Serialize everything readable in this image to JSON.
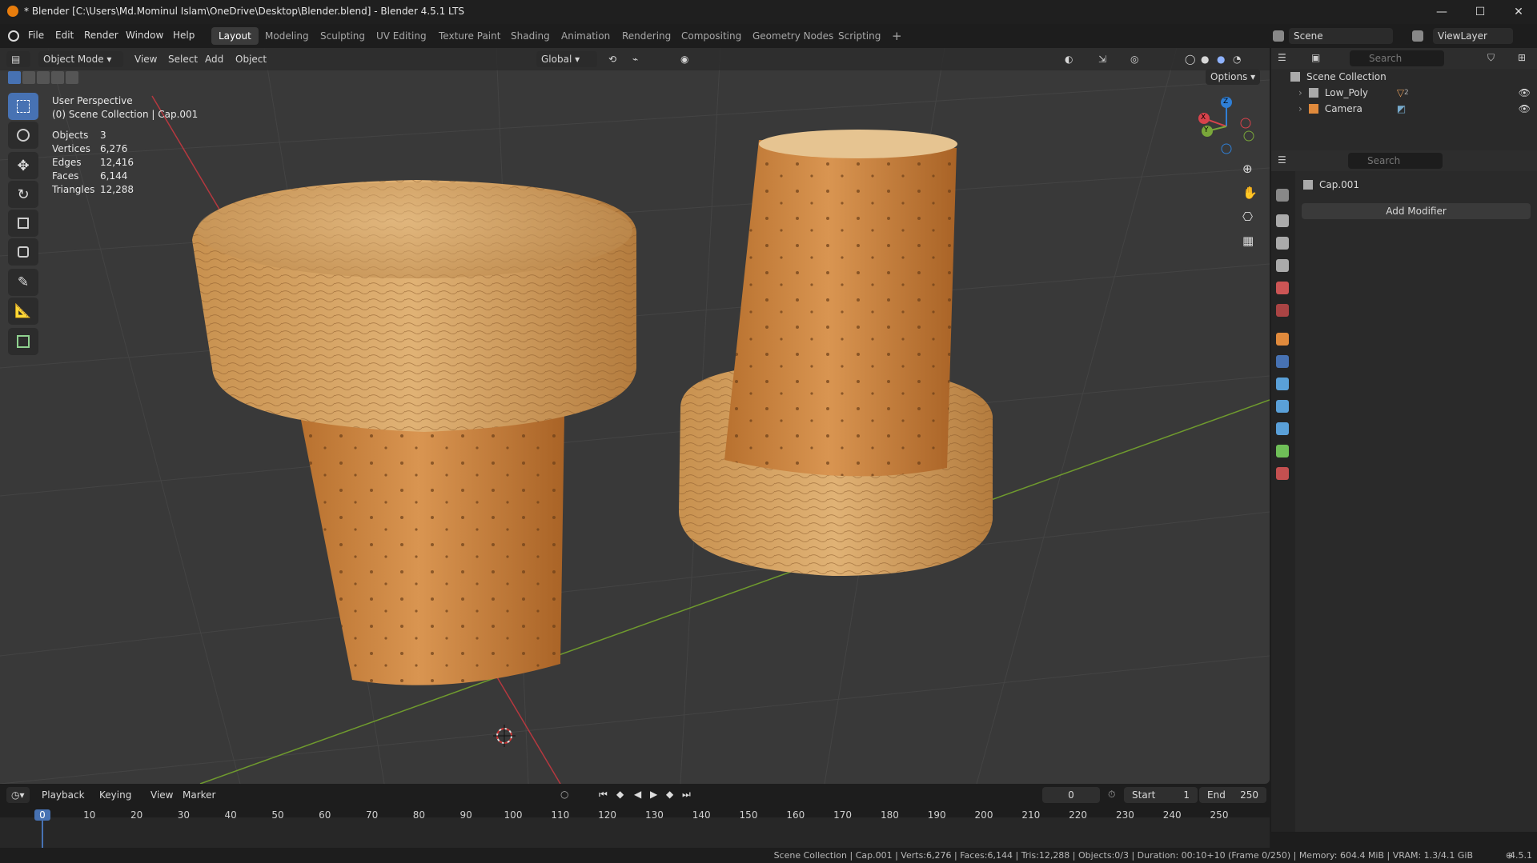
{
  "window": {
    "title": "* Blender [C:\\Users\\Md.Mominul Islam\\OneDrive\\Desktop\\Blender.blend] - Blender 4.5.1 LTS",
    "minimize": "—",
    "maximize": "☐",
    "close": "✕"
  },
  "menu": {
    "items": [
      "File",
      "Edit",
      "Render",
      "Window",
      "Help"
    ]
  },
  "workspaces": {
    "tabs": [
      "Layout",
      "Modeling",
      "Sculpting",
      "UV Editing",
      "Texture Paint",
      "Shading",
      "Animation",
      "Rendering",
      "Compositing",
      "Geometry Nodes",
      "Scripting"
    ],
    "active": "Layout",
    "add": "+"
  },
  "scene": {
    "label": "Scene",
    "viewlayer": "ViewLayer"
  },
  "viewport_header": {
    "mode": "Object Mode",
    "menus": [
      "View",
      "Select",
      "Add",
      "Object"
    ],
    "orientation": "Global",
    "options": "Options"
  },
  "overlay_info": {
    "perspective": "User Perspective",
    "collection": "(0) Scene Collection | Cap.001",
    "stats": [
      {
        "label": "Objects",
        "value": "3"
      },
      {
        "label": "Vertices",
        "value": "6,276"
      },
      {
        "label": "Edges",
        "value": "12,416"
      },
      {
        "label": "Faces",
        "value": "6,144"
      },
      {
        "label": "Triangles",
        "value": "12,288"
      }
    ]
  },
  "gizmo": {
    "x": "X",
    "y": "Y",
    "z": "Z"
  },
  "outliner": {
    "search_placeholder": "Search",
    "root": "Scene Collection",
    "items": [
      {
        "name": "Low_Poly",
        "badge": "2"
      },
      {
        "name": "Camera"
      }
    ]
  },
  "properties": {
    "search_placeholder": "Search",
    "object_name": "Cap.001",
    "add_modifier": "Add Modifier"
  },
  "timeline": {
    "menus": [
      "Playback",
      "Keying",
      "View",
      "Marker"
    ],
    "current_frame": "0",
    "start_label": "Start",
    "start_value": "1",
    "end_label": "End",
    "end_value": "250",
    "ticks": [
      "0",
      "10",
      "20",
      "30",
      "40",
      "50",
      "60",
      "70",
      "80",
      "90",
      "100",
      "110",
      "120",
      "130",
      "140",
      "150",
      "160",
      "170",
      "180",
      "190",
      "200",
      "210",
      "220",
      "230",
      "240",
      "250"
    ]
  },
  "statusbar": {
    "text": "Scene Collection | Cap.001 | Verts:6,276 | Faces:6,144 | Tris:12,288 | Objects:0/3 | Duration: 00:10+10 (Frame 0/250) | Memory: 604.4 MiB | VRAM: 1.3/4.1 GiB",
    "version": "4.5.1"
  },
  "colors": {
    "accent": "#4772b3",
    "viewport_bg": "#393939",
    "cork": "#c98a4a",
    "cork_top": "#d9ad76"
  }
}
